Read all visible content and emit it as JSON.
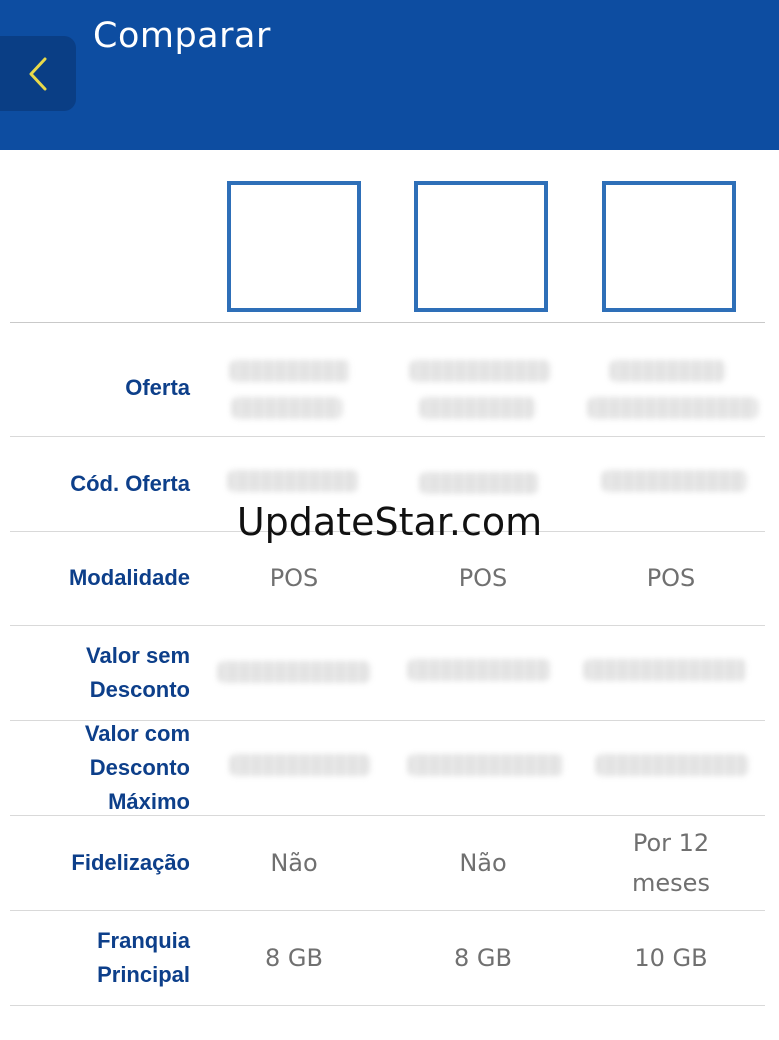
{
  "header": {
    "title": "Comparar"
  },
  "rows": [
    {
      "label": "Oferta",
      "values": [
        "",
        "",
        ""
      ]
    },
    {
      "label": "Cód. Oferta",
      "values": [
        "",
        "",
        ""
      ]
    },
    {
      "label": "Modalidade",
      "values": [
        "POS",
        "POS",
        "POS"
      ]
    },
    {
      "label": "Valor sem Desconto",
      "values": [
        "",
        "",
        ""
      ]
    },
    {
      "label": "Valor com Desconto Máximo",
      "values": [
        "",
        "",
        ""
      ]
    },
    {
      "label": "Fidelização",
      "values": [
        "Não",
        "Não",
        "Por 12 meses"
      ]
    },
    {
      "label": "Franquia Principal",
      "values": [
        "8 GB",
        "8 GB",
        "10 GB"
      ]
    }
  ],
  "watermark": "UpdateStar.com",
  "colors": {
    "header": "#0d4da1",
    "accent": "#2e6fb8",
    "label": "#0d3f8a",
    "back_arrow": "#e8d94a"
  },
  "icons": {
    "back": "chevron-left-icon"
  }
}
